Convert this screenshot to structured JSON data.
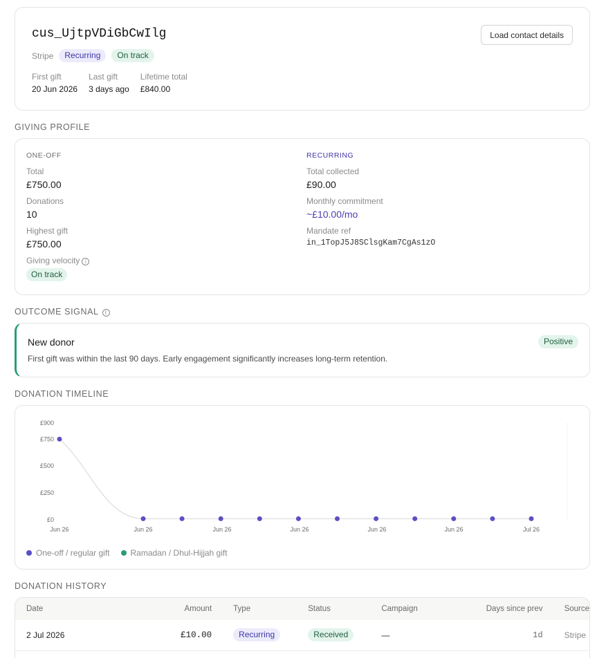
{
  "customer": {
    "id": "cus_UjtpVDiGbCwIlg",
    "load_contact_label": "Load contact details",
    "source": "Stripe",
    "badges": [
      "Recurring",
      "On track"
    ],
    "stats": [
      {
        "label": "First gift",
        "value": "20 Jun 2026"
      },
      {
        "label": "Last gift",
        "value": "3 days ago"
      },
      {
        "label": "Lifetime total",
        "value": "£840.00"
      }
    ]
  },
  "giving_profile": {
    "title": "GIVING PROFILE",
    "one_off": {
      "heading": "ONE-OFF",
      "total_label": "Total",
      "total": "£750.00",
      "donations_label": "Donations",
      "donations": "10",
      "highest_label": "Highest gift",
      "highest": "£750.00",
      "velocity_label": "Giving velocity",
      "velocity": "On track"
    },
    "recurring": {
      "heading": "RECURRING",
      "collected_label": "Total collected",
      "collected": "£90.00",
      "commitment_label": "Monthly commitment",
      "commitment": "~£10.00/mo",
      "mandate_label": "Mandate ref",
      "mandate": "in_1TopJ5J8SClsgKam7CgAs1zO"
    }
  },
  "outcome": {
    "title": "OUTCOME SIGNAL",
    "heading": "New donor",
    "badge": "Positive",
    "description": "First gift was within the last 90 days. Early engagement significantly increases long-term retention."
  },
  "timeline": {
    "title": "DONATION TIMELINE",
    "legend": [
      {
        "label": "One-off / regular gift",
        "color": "#5b4fc4"
      },
      {
        "label": "Ramadan / Dhul-Hijjah gift",
        "color": "#2a9d74"
      }
    ]
  },
  "chart_data": {
    "type": "line",
    "y_ticks": [
      "£900",
      "£750",
      "£500",
      "£250",
      "£0"
    ],
    "y_tick_values": [
      900,
      750,
      500,
      250,
      0
    ],
    "ylim": [
      0,
      900
    ],
    "x_ticks": [
      "Jun 26",
      "Jun 26",
      "Jun 26",
      "Jun 26",
      "Jun 26",
      "Jun 26",
      "Jul 26"
    ],
    "values": [
      750,
      10,
      10,
      10,
      10,
      10,
      10,
      10,
      10,
      10,
      10,
      10
    ],
    "point_color": "#5b4fc4",
    "line_color": "#e2e2e2"
  },
  "history": {
    "title": "DONATION HISTORY",
    "columns": [
      "Date",
      "Amount",
      "Type",
      "Status",
      "Campaign",
      "Days since prev",
      "Source"
    ],
    "rows": [
      {
        "date": "2 Jul 2026",
        "amount": "£10.00",
        "type": "Recurring",
        "status": "Received",
        "campaign": "—",
        "days": "1d",
        "source": "Stripe"
      }
    ]
  }
}
